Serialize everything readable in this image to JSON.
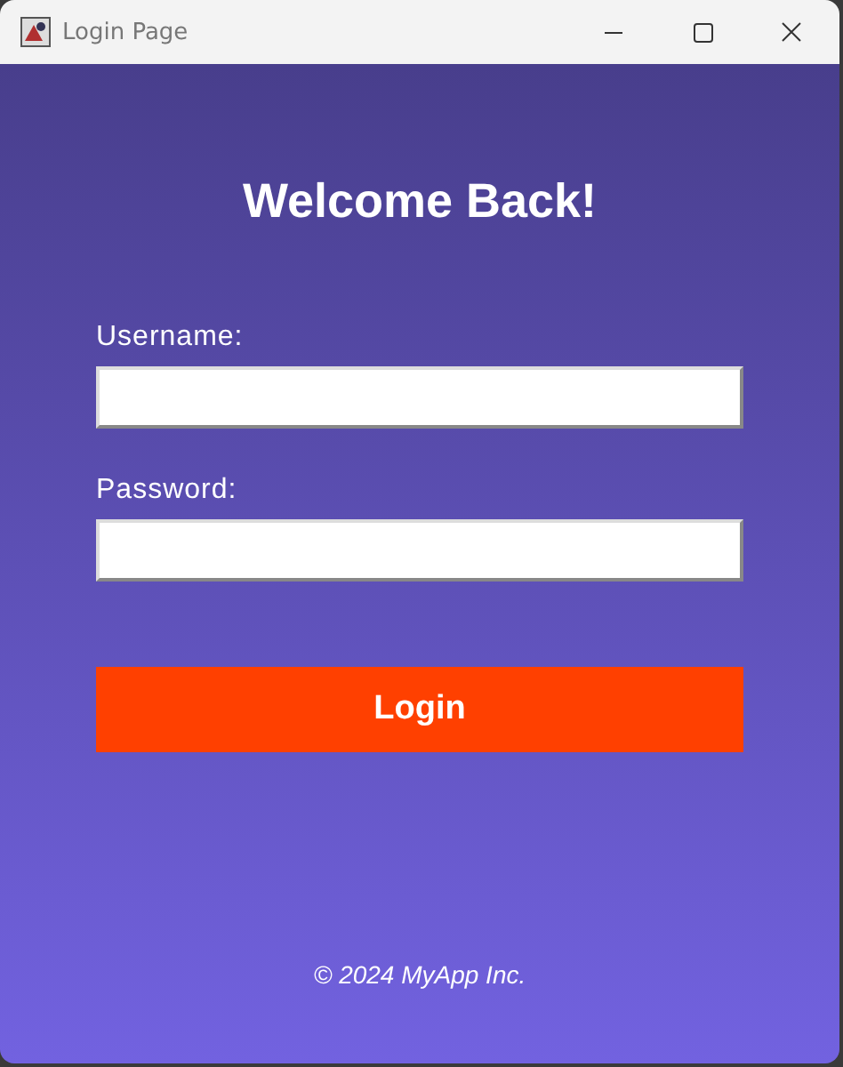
{
  "window": {
    "title": "Login Page"
  },
  "heading": "Welcome Back!",
  "fields": [
    {
      "label": "Username:"
    },
    {
      "label": "Password:"
    }
  ],
  "login_button": "Login",
  "footer": "© 2024 MyApp Inc."
}
